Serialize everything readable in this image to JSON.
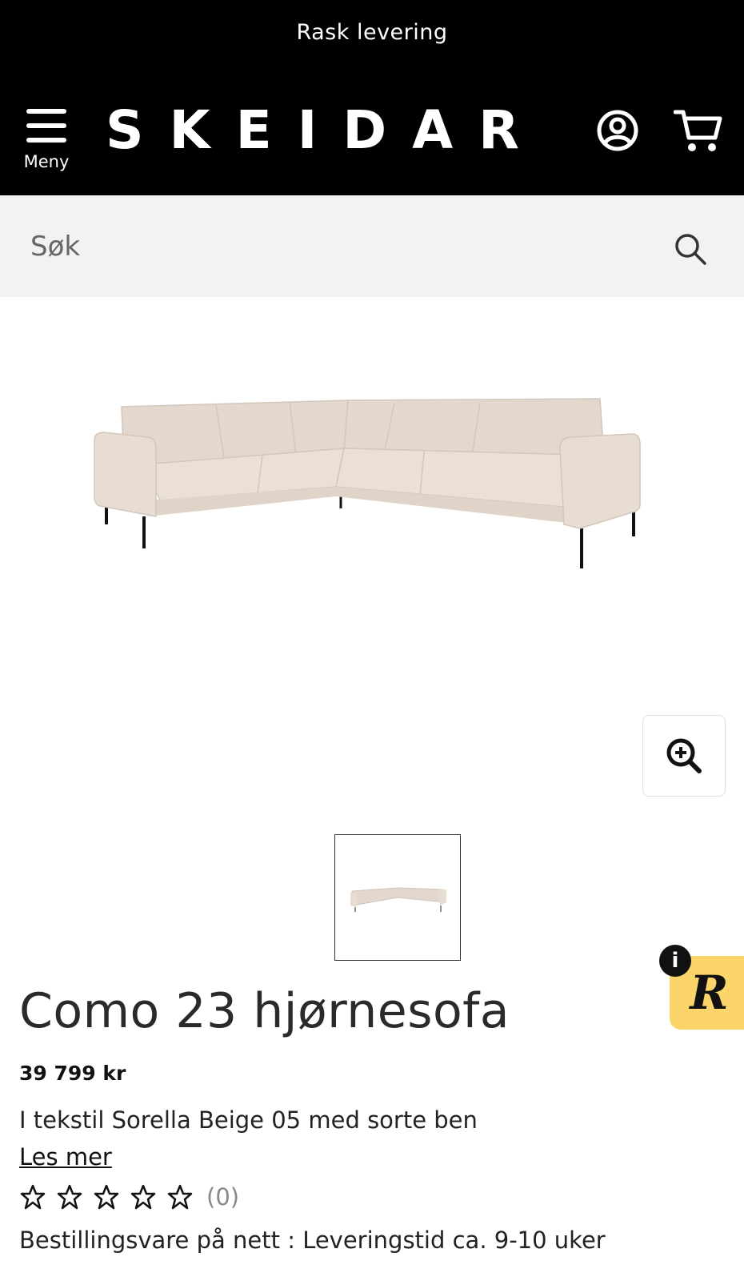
{
  "promo": {
    "text": "Rask levering"
  },
  "header": {
    "logo": "SKEIDAR",
    "menu_label": "Meny",
    "icons": [
      "menu-icon",
      "account-icon",
      "cart-icon"
    ]
  },
  "search": {
    "placeholder": "Søk",
    "icon": "search-icon"
  },
  "gallery": {
    "zoom_icon": "zoom-in-icon"
  },
  "product": {
    "title": "Como 23 hjørnesofa",
    "price": "39 799 kr",
    "description": "I tekstil Sorella Beige 05 med sorte ben",
    "read_more": "Les mer",
    "rating_stars": 5,
    "rating_value": 0,
    "rating_count": "(0)",
    "delivery": "Bestillingsvare på nett : Leveringstid ca. 9-10 uker"
  },
  "badge": {
    "letter": "R",
    "info": "i"
  },
  "colors": {
    "header_bg": "#000000",
    "search_bg": "#f2f2f2",
    "badge_bg": "#fbd569",
    "sofa": "#e8dcd3"
  }
}
